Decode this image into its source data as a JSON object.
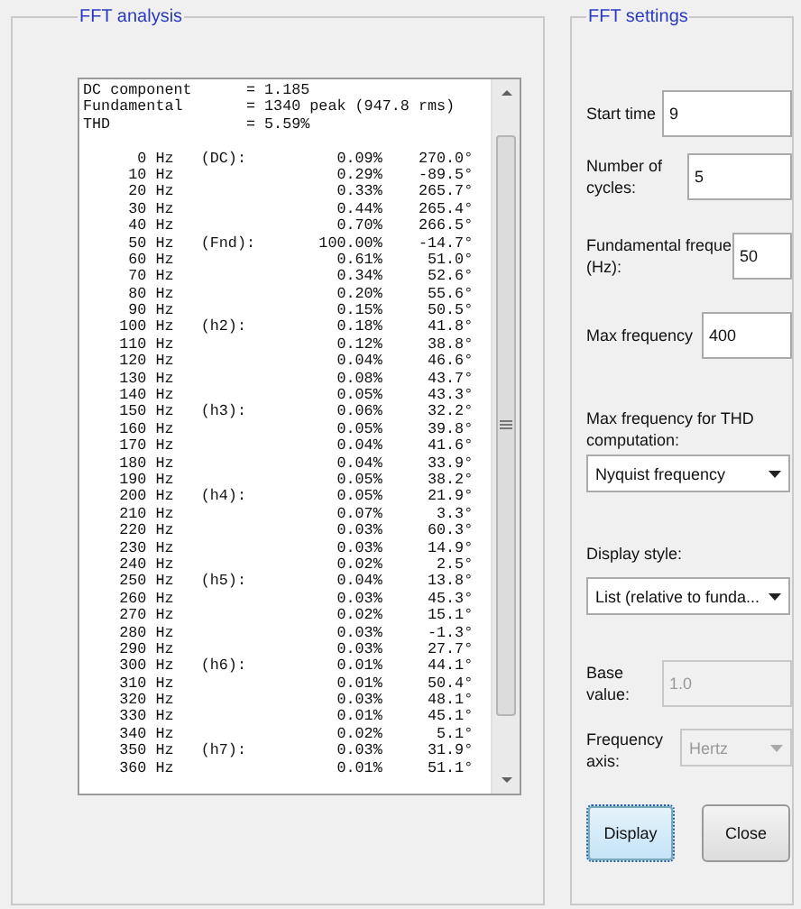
{
  "analysis": {
    "title": "FFT analysis",
    "summary": [
      {
        "label": "DC component",
        "value": "= 1.185"
      },
      {
        "label": "Fundamental",
        "value": "= 1340 peak (947.8 rms)"
      },
      {
        "label": "THD",
        "value": "= 5.59%"
      }
    ],
    "rows": [
      {
        "freq": "0 Hz",
        "harmonic": "(DC):",
        "percent": "0.09%",
        "phase": "270.0°"
      },
      {
        "freq": "10 Hz",
        "percent": "0.29%",
        "phase": "-89.5°"
      },
      {
        "freq": "20 Hz",
        "percent": "0.33%",
        "phase": "265.7°"
      },
      {
        "freq": "30 Hz",
        "percent": "0.44%",
        "phase": "265.4°"
      },
      {
        "freq": "40 Hz",
        "percent": "0.70%",
        "phase": "266.5°"
      },
      {
        "freq": "50 Hz",
        "harmonic": "(Fnd):",
        "percent": "100.00%",
        "phase": "-14.7°"
      },
      {
        "freq": "60 Hz",
        "percent": "0.61%",
        "phase": "51.0°"
      },
      {
        "freq": "70 Hz",
        "percent": "0.34%",
        "phase": "52.6°"
      },
      {
        "freq": "80 Hz",
        "percent": "0.20%",
        "phase": "55.6°"
      },
      {
        "freq": "90 Hz",
        "percent": "0.15%",
        "phase": "50.5°"
      },
      {
        "freq": "100 Hz",
        "harmonic": "(h2):",
        "percent": "0.18%",
        "phase": "41.8°"
      },
      {
        "freq": "110 Hz",
        "percent": "0.12%",
        "phase": "38.8°"
      },
      {
        "freq": "120 Hz",
        "percent": "0.04%",
        "phase": "46.6°"
      },
      {
        "freq": "130 Hz",
        "percent": "0.08%",
        "phase": "43.7°"
      },
      {
        "freq": "140 Hz",
        "percent": "0.05%",
        "phase": "43.3°"
      },
      {
        "freq": "150 Hz",
        "harmonic": "(h3):",
        "percent": "0.06%",
        "phase": "32.2°"
      },
      {
        "freq": "160 Hz",
        "percent": "0.05%",
        "phase": "39.8°"
      },
      {
        "freq": "170 Hz",
        "percent": "0.04%",
        "phase": "41.6°"
      },
      {
        "freq": "180 Hz",
        "percent": "0.04%",
        "phase": "33.9°"
      },
      {
        "freq": "190 Hz",
        "percent": "0.05%",
        "phase": "38.2°"
      },
      {
        "freq": "200 Hz",
        "harmonic": "(h4):",
        "percent": "0.05%",
        "phase": "21.9°"
      },
      {
        "freq": "210 Hz",
        "percent": "0.07%",
        "phase": "3.3°"
      },
      {
        "freq": "220 Hz",
        "percent": "0.03%",
        "phase": "60.3°"
      },
      {
        "freq": "230 Hz",
        "percent": "0.03%",
        "phase": "14.9°"
      },
      {
        "freq": "240 Hz",
        "percent": "0.02%",
        "phase": "2.5°"
      },
      {
        "freq": "250 Hz",
        "harmonic": "(h5):",
        "percent": "0.04%",
        "phase": "13.8°"
      },
      {
        "freq": "260 Hz",
        "percent": "0.03%",
        "phase": "45.3°"
      },
      {
        "freq": "270 Hz",
        "percent": "0.02%",
        "phase": "15.1°"
      },
      {
        "freq": "280 Hz",
        "percent": "0.03%",
        "phase": "-1.3°"
      },
      {
        "freq": "290 Hz",
        "percent": "0.03%",
        "phase": "27.7°"
      },
      {
        "freq": "300 Hz",
        "harmonic": "(h6):",
        "percent": "0.01%",
        "phase": "44.1°"
      },
      {
        "freq": "310 Hz",
        "percent": "0.01%",
        "phase": "50.4°"
      },
      {
        "freq": "320 Hz",
        "percent": "0.03%",
        "phase": "48.1°"
      },
      {
        "freq": "330 Hz",
        "percent": "0.01%",
        "phase": "45.1°"
      },
      {
        "freq": "340 Hz",
        "percent": "0.02%",
        "phase": "5.1°"
      },
      {
        "freq": "350 Hz",
        "harmonic": "(h7):",
        "percent": "0.03%",
        "phase": "31.9°"
      },
      {
        "freq": "360 Hz",
        "percent": "0.01%",
        "phase": "51.1°"
      }
    ]
  },
  "settings": {
    "title": "FFT settings",
    "start_time": {
      "label": "Start time",
      "value": "9"
    },
    "cycles": {
      "label": "Number of cycles:",
      "value": "5"
    },
    "fundamental": {
      "label": "Fundamental freque",
      "label_2": "(Hz):",
      "value": "50"
    },
    "max_frequency": {
      "label": "Max frequency",
      "value": "400"
    },
    "thd_max": {
      "label": "Max frequency for THD computation:",
      "value": "Nyquist frequency"
    },
    "display_style": {
      "label": "Display style:",
      "value": "List (relative to funda..."
    },
    "base_value": {
      "label": "Base value:",
      "value": "1.0",
      "disabled": true
    },
    "frequency_axis": {
      "label": "Frequency axis:",
      "value": "Hertz",
      "disabled": true
    },
    "buttons": [
      {
        "label": "Display",
        "focused": true
      },
      {
        "label": "Close",
        "focused": false
      }
    ]
  }
}
